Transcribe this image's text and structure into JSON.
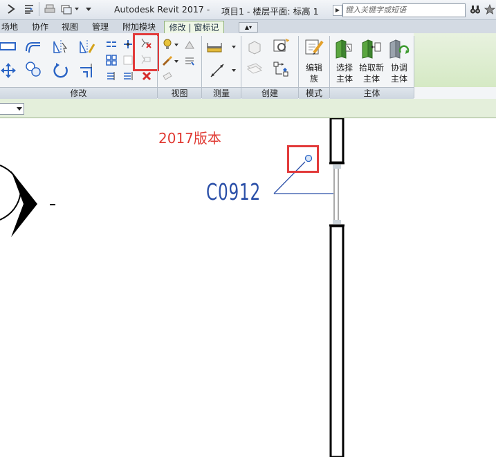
{
  "titlebar": {
    "app_title": "Autodesk Revit 2017 -",
    "doc_title": "项目1 - 楼层平面: 标高 1",
    "search_placeholder": "键入关键字或短语"
  },
  "tabs": [
    {
      "label": "场地"
    },
    {
      "label": "协作"
    },
    {
      "label": "视图"
    },
    {
      "label": "管理"
    },
    {
      "label": "附加模块"
    },
    {
      "label": "修改 | 窗标记",
      "active": true
    }
  ],
  "ribbon": {
    "panels": {
      "modify": "修改",
      "view": "视图",
      "measure": "测量",
      "create": "创建",
      "mode": "模式",
      "host": "主体"
    },
    "mode_buttons": {
      "edit_family_line1": "编辑",
      "edit_family_line2": "族"
    },
    "host_buttons": {
      "pick_host_line1": "选择",
      "pick_host_line2": "主体",
      "pick_new_host_line1": "拾取新",
      "pick_new_host_line2": "主体",
      "reconcile_host_line1": "协调",
      "reconcile_host_line2": "主体"
    }
  },
  "canvas": {
    "version_note": "2017版本",
    "tag_text": "C0912"
  },
  "colors": {
    "highlight": "#e23a3a",
    "tag_blue": "#2a4fa8",
    "active_tab": "#eef6e6",
    "host_green": "#4a9a3a"
  }
}
